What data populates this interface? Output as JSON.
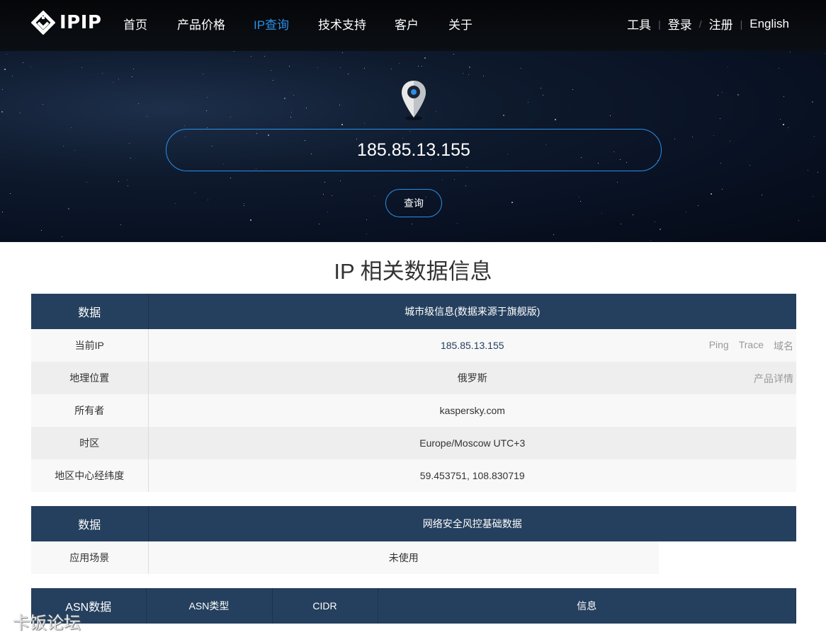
{
  "nav": {
    "logo_text": "IPIP",
    "items": [
      "首页",
      "产品价格",
      "IP查询",
      "技术支持",
      "客户",
      "关于"
    ],
    "right": [
      "工具",
      "登录",
      "注册",
      "English"
    ],
    "right_seps": [
      "|",
      "/",
      "|"
    ]
  },
  "hero": {
    "ip_value": "185.85.13.155",
    "query_label": "查询"
  },
  "section_title": "IP 相关数据信息",
  "city_table": {
    "header_col1": "数据",
    "header_col2": "城市级信息(数据来源于旗舰版)",
    "rows": [
      {
        "label": "当前IP",
        "value": "185.85.13.155"
      },
      {
        "label": "地理位置",
        "value": "俄罗斯"
      },
      {
        "label": "所有者",
        "value": "kaspersky.com"
      },
      {
        "label": "时区",
        "value": "Europe/Moscow UTC+3"
      },
      {
        "label": "地区中心经纬度",
        "value": "59.453751, 108.830719"
      }
    ],
    "ip_links": [
      "Ping",
      "Trace",
      "域名"
    ],
    "geo_link": "产品详情"
  },
  "risk_table": {
    "header_col1": "数据",
    "header_col2": "网络安全风控基础数据",
    "row_label": "应用场景",
    "row_value": "未使用"
  },
  "asn_table": {
    "headers": [
      "ASN数据",
      "ASN类型",
      "CIDR",
      "信息"
    ]
  },
  "watermark": "卡饭论坛",
  "colors": {
    "accent": "#2b8fe8",
    "table_header": "#25405e"
  }
}
